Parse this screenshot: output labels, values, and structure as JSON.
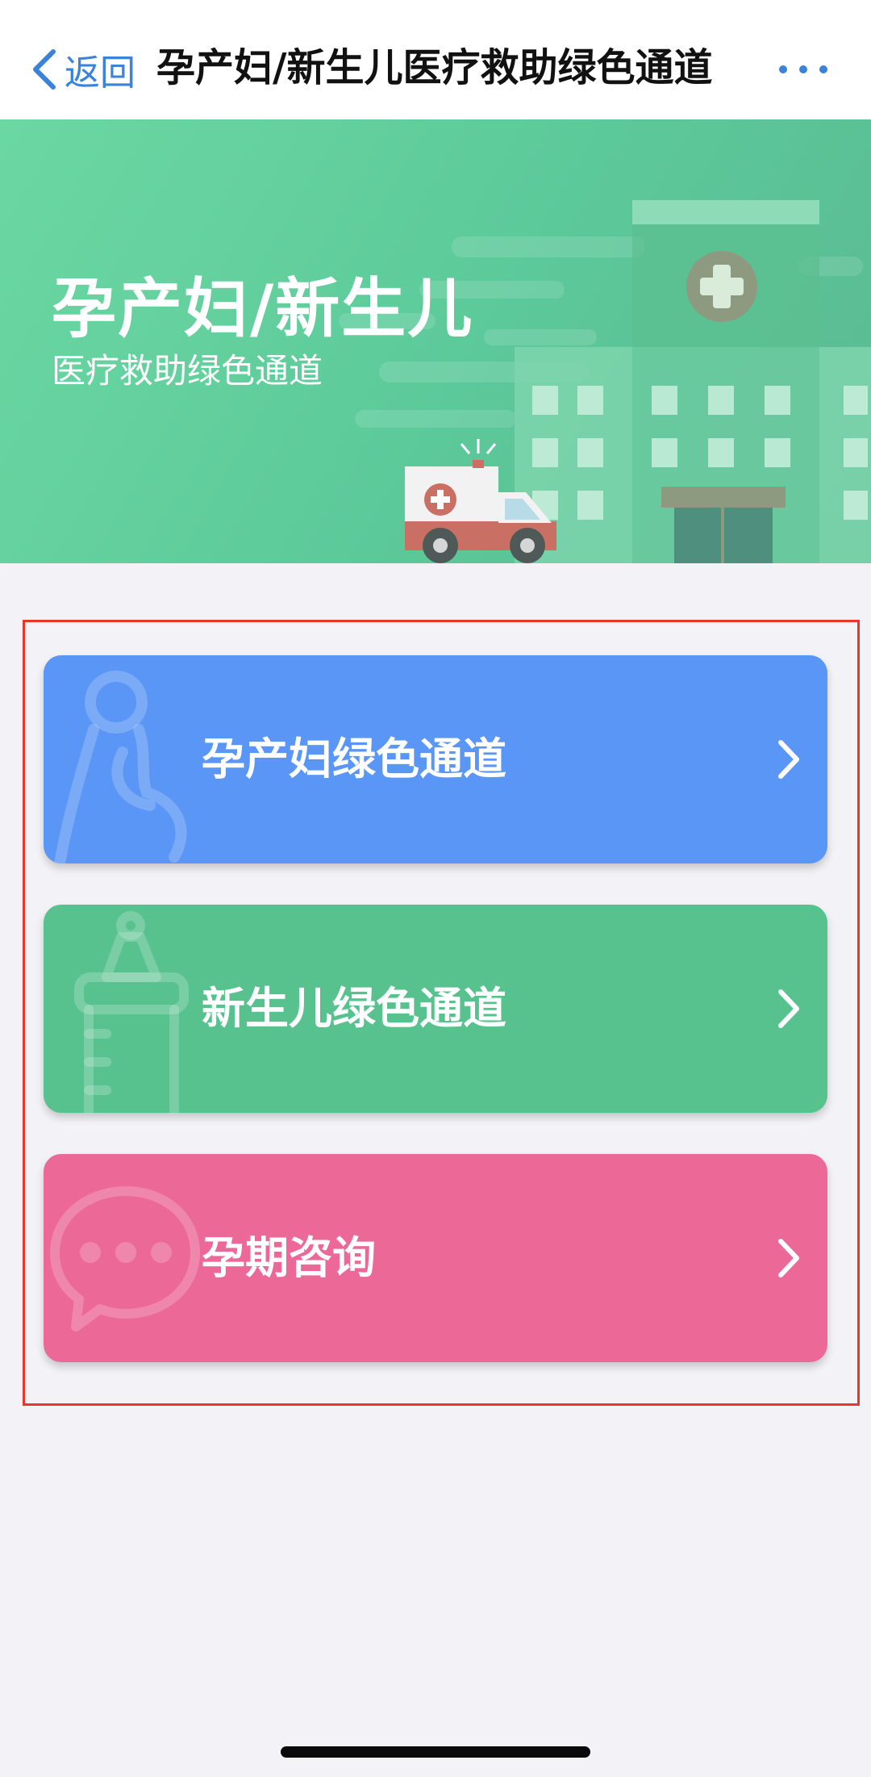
{
  "nav": {
    "back_label": "返回",
    "title": "孕产妇/新生儿医疗救助绿色通道",
    "more_icon": "more-dots-icon"
  },
  "banner": {
    "title": "孕产妇/新生儿",
    "subtitle": "医疗救助绿色通道"
  },
  "menu": {
    "items": [
      {
        "label": "孕产妇绿色通道",
        "icon": "pregnant-woman-icon",
        "color": "#5a96f5"
      },
      {
        "label": "新生儿绿色通道",
        "icon": "baby-bottle-icon",
        "color": "#58c28f"
      },
      {
        "label": "孕期咨询",
        "icon": "chat-bubble-icon",
        "color": "#ec6897"
      }
    ]
  },
  "colors": {
    "accent": "#3a83d8",
    "highlight_frame": "#e8362c",
    "banner": "#5cc99a"
  }
}
